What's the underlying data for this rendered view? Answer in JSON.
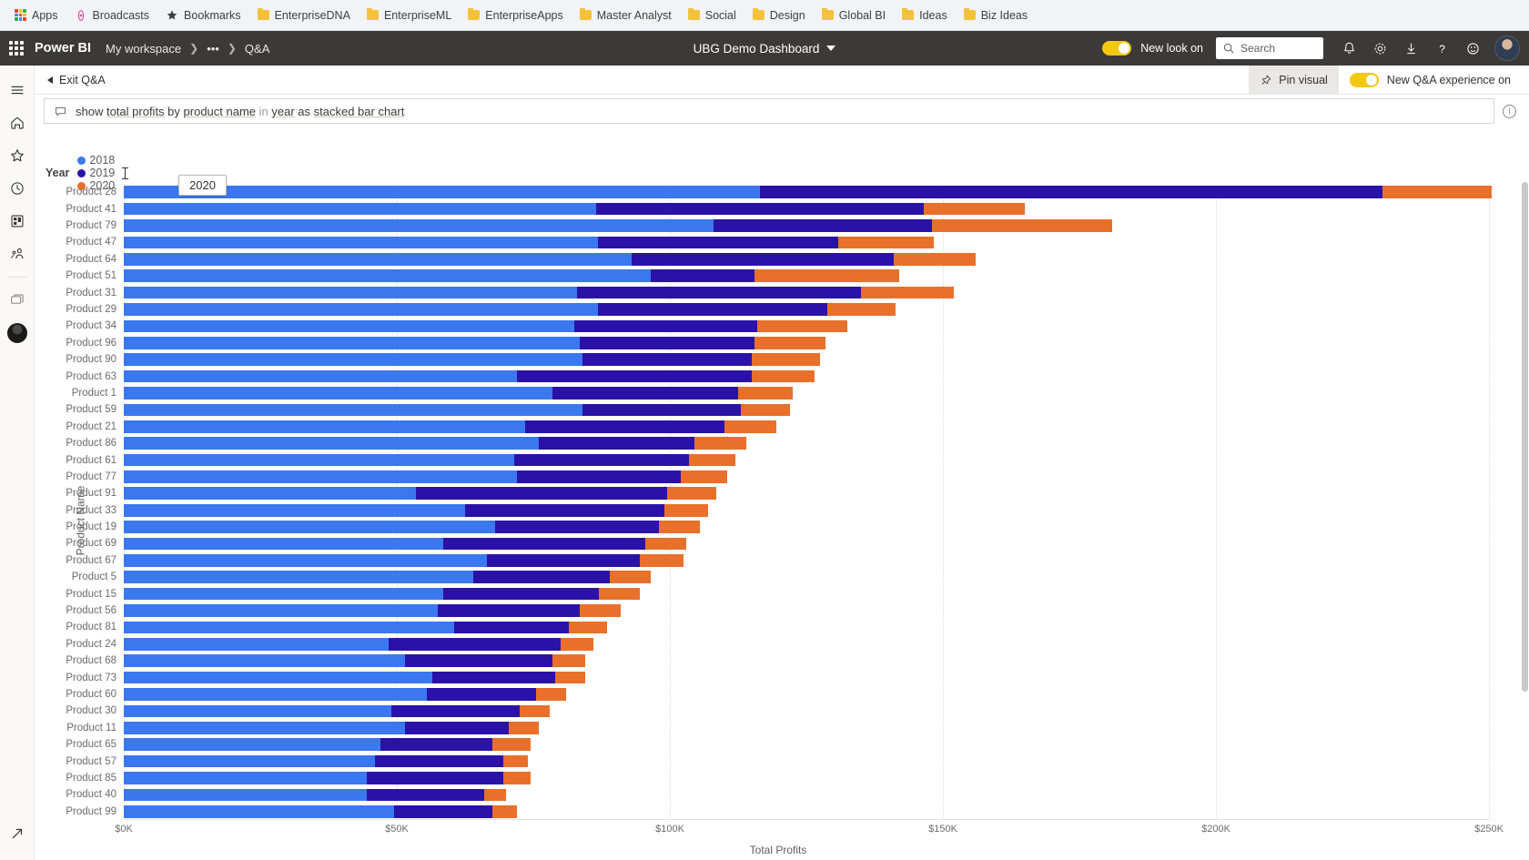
{
  "browser": {
    "bookmarks": [
      {
        "label": "Apps",
        "icon": "apps-grid-icon"
      },
      {
        "label": "Broadcasts",
        "icon": "broadcast-icon"
      },
      {
        "label": "Bookmarks",
        "icon": "star-icon"
      },
      {
        "label": "EnterpriseDNA",
        "icon": "folder-icon"
      },
      {
        "label": "EnterpriseML",
        "icon": "folder-icon"
      },
      {
        "label": "EnterpriseApps",
        "icon": "folder-icon"
      },
      {
        "label": "Master Analyst",
        "icon": "folder-icon"
      },
      {
        "label": "Social",
        "icon": "folder-icon"
      },
      {
        "label": "Design",
        "icon": "folder-icon"
      },
      {
        "label": "Global BI",
        "icon": "folder-icon"
      },
      {
        "label": "Ideas",
        "icon": "folder-icon"
      },
      {
        "label": "Biz Ideas",
        "icon": "folder-icon"
      }
    ]
  },
  "header": {
    "brand": "Power BI",
    "breadcrumb": [
      "My workspace",
      "•••",
      "Q&A"
    ],
    "report_title": "UBG Demo Dashboard",
    "new_look_label": "New look on",
    "search_placeholder": "Search",
    "icons": [
      "waffle-icon",
      "notifications-icon",
      "settings-icon",
      "download-icon",
      "help-icon",
      "feedback-icon",
      "account-avatar"
    ]
  },
  "left_rail": {
    "items": [
      {
        "name": "hamburger-menu",
        "label": "Navigation"
      },
      {
        "name": "home",
        "label": "Home"
      },
      {
        "name": "favorites",
        "label": "Favorites"
      },
      {
        "name": "recent",
        "label": "Recent"
      },
      {
        "name": "apps",
        "label": "Apps"
      },
      {
        "name": "shared-with-me",
        "label": "Shared with me"
      },
      {
        "name": "workspaces",
        "label": "Workspaces"
      },
      {
        "name": "my-workspace",
        "label": "My workspace"
      }
    ],
    "bottom_item": {
      "name": "get-data",
      "label": "Get data"
    }
  },
  "action_bar": {
    "exit_label": "Exit Q&A",
    "pin_visual_label": "Pin visual",
    "qa_experience_label": "New Q&A experience on"
  },
  "query": {
    "icon": "chat-bubble-icon",
    "parts": [
      {
        "text": "show ",
        "style": "plain"
      },
      {
        "text": "total profits",
        "style": "underline"
      },
      {
        "text": " by ",
        "style": "plain"
      },
      {
        "text": "product name",
        "style": "underline"
      },
      {
        "text": " in ",
        "style": "dim"
      },
      {
        "text": "year",
        "style": "underline"
      },
      {
        "text": " as ",
        "style": "plain"
      },
      {
        "text": "stacked bar chart",
        "style": "underline"
      }
    ],
    "full_text": "show total profits by product name in year as stacked bar chart"
  },
  "tooltip": {
    "text": "2020"
  },
  "chart_data": {
    "type": "bar",
    "orientation": "horizontal",
    "stacked": true,
    "title": "",
    "xlabel": "Total Profits",
    "ylabel": "Product Name",
    "legend_title": "Year",
    "legend_position": "top-left",
    "grid": true,
    "xlim": [
      0,
      250000
    ],
    "xticks": [
      "$0K",
      "$50K",
      "$100K",
      "$150K",
      "$200K",
      "$250K"
    ],
    "xtick_values": [
      0,
      50000,
      100000,
      150000,
      200000,
      250000
    ],
    "series": [
      {
        "name": "2018",
        "color": "#3b78f0"
      },
      {
        "name": "2019",
        "color": "#2a12a8"
      },
      {
        "name": "2020",
        "color": "#e8702a"
      }
    ],
    "categories": [
      "Product 28",
      "Product 41",
      "Product 79",
      "Product 47",
      "Product 64",
      "Product 51",
      "Product 31",
      "Product 29",
      "Product 34",
      "Product 96",
      "Product 90",
      "Product 63",
      "Product 1",
      "Product 59",
      "Product 21",
      "Product 86",
      "Product 61",
      "Product 77",
      "Product 91",
      "Product 33",
      "Product 19",
      "Product 69",
      "Product 67",
      "Product 5",
      "Product 15",
      "Product 56",
      "Product 81",
      "Product 24",
      "Product 68",
      "Product 73",
      "Product 60",
      "Product 30",
      "Product 11",
      "Product 65",
      "Product 57",
      "Product 85",
      "Product 40",
      "Product 99"
    ],
    "values": [
      [
        116500,
        114000,
        20000
      ],
      [
        86500,
        60000,
        18500
      ],
      [
        108000,
        40000,
        33000
      ],
      [
        86800,
        44000,
        17500
      ],
      [
        93000,
        48000,
        15000
      ],
      [
        96500,
        19000,
        26500
      ],
      [
        83000,
        52000,
        17000
      ],
      [
        86800,
        42000,
        12500
      ],
      [
        82500,
        33500,
        16500
      ],
      [
        83500,
        32000,
        13000
      ],
      [
        84000,
        31000,
        12500
      ],
      [
        72000,
        43000,
        11500
      ],
      [
        78500,
        34000,
        10000
      ],
      [
        84000,
        29000,
        9000
      ],
      [
        73500,
        36500,
        9500
      ],
      [
        76000,
        28500,
        9500
      ],
      [
        71500,
        32000,
        8500
      ],
      [
        72000,
        30000,
        8500
      ],
      [
        53500,
        46000,
        9000
      ],
      [
        62500,
        36500,
        8000
      ],
      [
        68000,
        30000,
        7500
      ],
      [
        58500,
        37000,
        7500
      ],
      [
        66500,
        28000,
        8000
      ],
      [
        64000,
        25000,
        7500
      ],
      [
        58500,
        28500,
        7500
      ],
      [
        57500,
        26000,
        7500
      ],
      [
        60500,
        21000,
        7000
      ],
      [
        48500,
        31500,
        6000
      ],
      [
        51500,
        27000,
        6000
      ],
      [
        56500,
        22500,
        5500
      ],
      [
        55500,
        20000,
        5500
      ],
      [
        49000,
        23500,
        5500
      ],
      [
        51500,
        19000,
        5500
      ],
      [
        47000,
        20500,
        7000
      ],
      [
        46000,
        23500,
        4500
      ],
      [
        44500,
        25000,
        5000
      ],
      [
        44500,
        21500,
        4000
      ],
      [
        49500,
        18000,
        4500
      ]
    ]
  }
}
